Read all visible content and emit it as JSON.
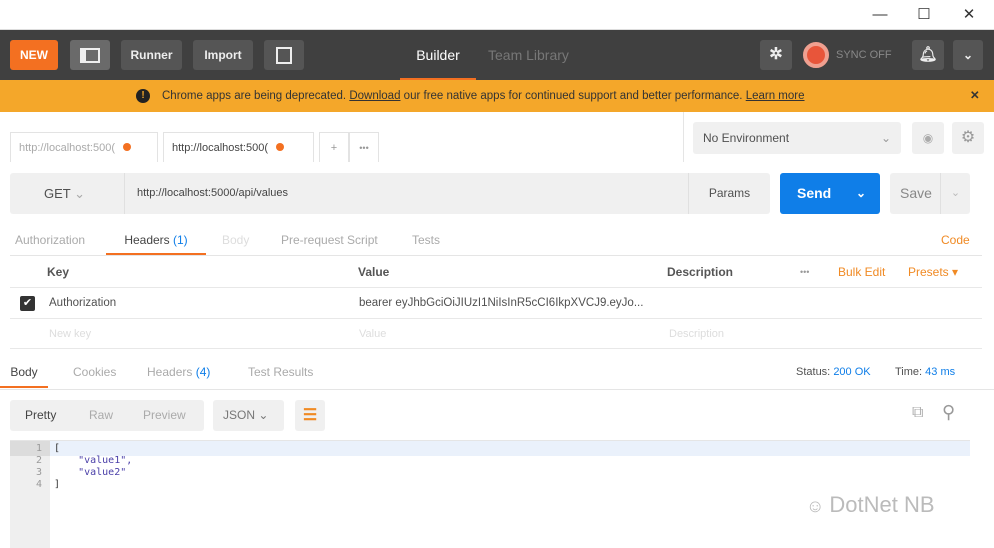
{
  "window": {
    "minimize": "—",
    "maximize": "☐",
    "close": "✕"
  },
  "toolbar": {
    "new": "NEW",
    "runner": "Runner",
    "import": "Import",
    "builder": "Builder",
    "team_library": "Team Library",
    "sync": "SYNC OFF"
  },
  "banner": {
    "text1": "Chrome apps are being deprecated. ",
    "download": "Download",
    "text2": " our free native apps for continued support and better performance. ",
    "learn_more": "Learn more",
    "close": "✕"
  },
  "tabs": [
    {
      "label": "http://localhost:500("
    },
    {
      "label": "http://localhost:500("
    }
  ],
  "tab_add": "+",
  "tab_more": "•••",
  "environment": {
    "selected": "No Environment"
  },
  "request": {
    "method": "GET",
    "url": "http://localhost:5000/api/values",
    "params": "Params",
    "send": "Send",
    "save": "Save"
  },
  "req_tabs": {
    "authorization": "Authorization",
    "headers": "Headers",
    "headers_count": "(1)",
    "body": "Body",
    "prerequest": "Pre-request Script",
    "tests": "Tests",
    "code": "Code"
  },
  "headers_table": {
    "key": "Key",
    "value": "Value",
    "description": "Description",
    "more": "•••",
    "bulk_edit": "Bulk Edit",
    "presets": "Presets ▾",
    "rows": [
      {
        "key": "Authorization",
        "value": "bearer eyJhbGciOiJIUzI1NiIsInR5cCI6IkpXVCJ9.eyJo..."
      }
    ],
    "placeholder": {
      "key": "New key",
      "value": "Value",
      "description": "Description"
    }
  },
  "response_tabs": {
    "body": "Body",
    "cookies": "Cookies",
    "headers": "Headers",
    "headers_count": "(4)",
    "test_results": "Test Results"
  },
  "status": {
    "label": "Status:",
    "value": "200 OK",
    "time_label": "Time:",
    "time_value": "43 ms"
  },
  "view": {
    "pretty": "Pretty",
    "raw": "Raw",
    "preview": "Preview",
    "format": "JSON"
  },
  "code_lines": [
    {
      "n": "1",
      "t": "["
    },
    {
      "n": "2",
      "t": "    \"value1\","
    },
    {
      "n": "3",
      "t": "    \"value2\""
    },
    {
      "n": "4",
      "t": "]"
    }
  ],
  "watermark": "DotNet NB",
  "colors": {
    "orange": "#f37021",
    "blue": "#0f7ee8",
    "banner": "#f4a72a"
  }
}
